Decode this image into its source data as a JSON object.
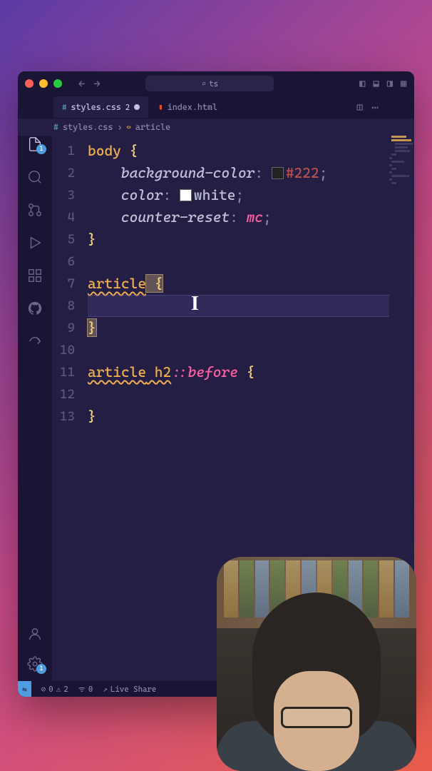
{
  "titlebar": {
    "search_placeholder": "ts"
  },
  "tabs": {
    "active": {
      "name": "styles.css",
      "badge": "2"
    },
    "inactive": {
      "name": "index.html"
    }
  },
  "breadcrumb": {
    "file": "styles.css",
    "symbol": "article"
  },
  "activity": {
    "explorer_badge": "1",
    "gear_badge": "1"
  },
  "code": {
    "lines": [
      "1",
      "2",
      "3",
      "4",
      "5",
      "6",
      "7",
      "8",
      "9",
      "10",
      "11",
      "12",
      "13"
    ],
    "l1_sel": "body",
    "l1_brace": " {",
    "l2_prop": "background-color",
    "l2_col": ": ",
    "l2_hex": "#222",
    "l2_semi": ";",
    "l2_swatch": "#222222",
    "l3_prop": "color",
    "l3_col": ": ",
    "l3_val": "white",
    "l3_semi": ";",
    "l3_swatch": "#ffffff",
    "l4_prop": "counter-reset",
    "l4_col": ": ",
    "l4_val": "mc",
    "l4_semi": ";",
    "l5_brace": "}",
    "l7_sel": "article",
    "l7_brace": " {",
    "l9_brace": "}",
    "l11_sel1": "article",
    "l11_sel2": " h2",
    "l11_pseudo": "::before",
    "l11_brace": " {",
    "l13_brace": "}"
  },
  "statusbar": {
    "errors": "0",
    "warnings": "2",
    "port": "0",
    "live_share": "Live Share"
  }
}
